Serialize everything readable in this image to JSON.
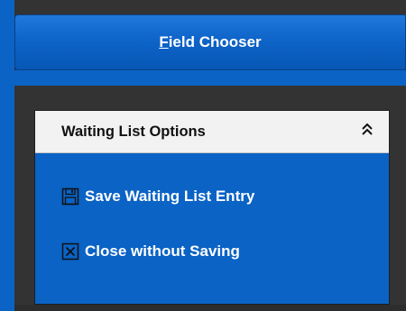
{
  "field_chooser": {
    "accelerator": "F",
    "label_rest": "ield Chooser"
  },
  "panel": {
    "title": "Waiting List Options",
    "collapse_icon": "double-chevron-up-icon",
    "items": [
      {
        "icon": "save-floppy-icon",
        "label": "Save Waiting List Entry"
      },
      {
        "icon": "close-box-icon",
        "label": "Close without Saving"
      }
    ]
  },
  "colors": {
    "accent_blue": "#0a63c5",
    "panel_header_bg": "#f2f2f2",
    "background_dark": "#333333"
  }
}
